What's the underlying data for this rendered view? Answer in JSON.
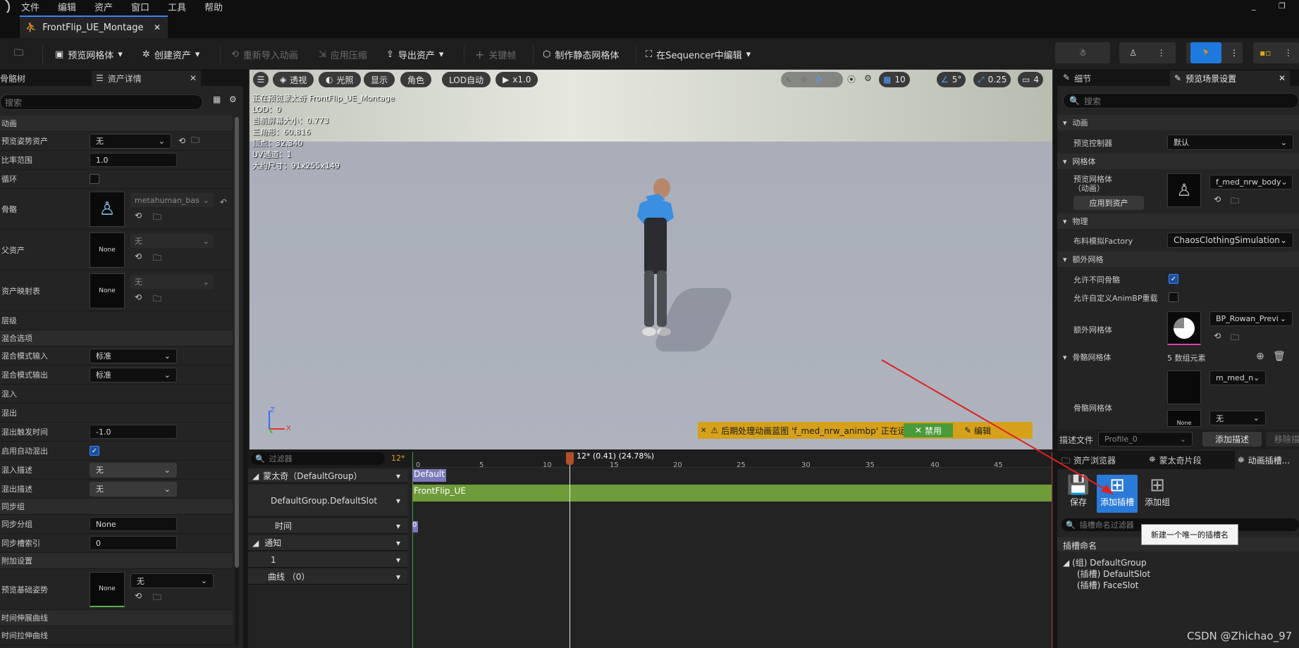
{
  "menu": [
    "文件",
    "编辑",
    "资产",
    "窗口",
    "工具",
    "帮助"
  ],
  "doc_tab": {
    "title": "FrontFlip_UE_Montage"
  },
  "toolbar": {
    "preview_mesh": "预览网格体",
    "create_asset": "创建资产",
    "reimport": "重新导入动画",
    "apply_compress": "应用压缩",
    "export_asset": "导出资产",
    "keyframe": "关键帧",
    "make_static_mesh": "制作静态网格体",
    "edit_in_sequencer": "在Sequencer中编辑"
  },
  "left_tabs": {
    "skeleton_tree": "骨骼树",
    "asset_details": "资产详情"
  },
  "left_search": {
    "placeholder": "搜索"
  },
  "details": {
    "sec_anim": "动画",
    "preview_pose_label": "预览姿势资产",
    "preview_pose_value": "无",
    "rate_label": "比率范围",
    "rate_value": "1.0",
    "loop_label": "循环",
    "skeleton_label": "骨骼",
    "skeleton_value": "metahuman_bas",
    "asset_label": "父资产",
    "asset_value": "无",
    "none1": "None",
    "asset_map_label": "资产映射表",
    "asset_map_value": "无",
    "none2": "None",
    "sec_level": "层级",
    "sec_blend": "混合选项",
    "blend_in_label": "混合模式输入",
    "blend_in_value": "标准",
    "blend_out_label": "混合模式输出",
    "blend_out_value": "标准",
    "blend_in2": "混入",
    "blend_out2": "混出",
    "blend_out_trigger_label": "混出触发时间",
    "blend_out_trigger_value": "-1.0",
    "auto_blend_out_label": "启用自动混出",
    "blend_in_profile_label": "混入描述",
    "blend_in_profile_value": "无",
    "blend_out_profile_label": "混出描述",
    "blend_out_profile_value": "无",
    "sec_sync": "同步组",
    "sync_group_label": "同步分组",
    "sync_group_value": "None",
    "sync_slot_label": "同步槽索引",
    "sync_slot_value": "0",
    "sec_additive": "附加设置",
    "base_pose_label": "预览基础姿势",
    "base_pose_value": "无",
    "none3": "None",
    "sec_timestretch": "时间伸展曲线",
    "timestretch_item": "时间拉伸曲线"
  },
  "viewport": {
    "perspective": "透视",
    "lit": "光照",
    "show": "显示",
    "character": "角色",
    "lod": "LOD自动",
    "play_rate": "x1.0",
    "grid": "10",
    "angle": "5°",
    "scale": "0.25",
    "cam": "4",
    "info": [
      "正在预览蒙太奇 FrontFlip_UE_Montage",
      "LOD：0",
      "当前屏幕大小：0.773",
      "三角形：60,816",
      "顶点：32,340",
      "UV通道：1",
      "大约尺寸：91x255x149"
    ],
    "axis_z": "Z",
    "axis_x": "X"
  },
  "warning": {
    "text": "后期处理动画蓝图 'f_med_nrw_animbp' 正在运行。",
    "disable": "禁用",
    "edit": "编辑"
  },
  "timeline": {
    "filter_placeholder": "过滤器",
    "frame_count": "12*",
    "playhead": "12* (0.41) (24.78%)",
    "ticks": [
      "0",
      "5",
      "10",
      "15",
      "20",
      "25",
      "30",
      "35",
      "40",
      "45"
    ],
    "montage_row": "蒙太奇（DefaultGroup）",
    "slot_row": "DefaultGroup.DefaultSlot",
    "time_row": "时间",
    "notify_row": "通知",
    "notify_track": "1",
    "curves_row": "曲线 （0）",
    "section_default": "Default",
    "anim_segment": "FrontFlip_UE",
    "time_marker": "0"
  },
  "right_tabs": {
    "details": "细节",
    "preview_scene": "预览场景设置"
  },
  "right_search": {
    "placeholder": "搜索"
  },
  "preview_scene": {
    "sec_anim": "动画",
    "controller_label": "预览控制器",
    "controller_value": "默认",
    "sec_mesh": "网格体",
    "preview_mesh_label": "预览网格体\n（动画）",
    "preview_mesh_value": "f_med_nrw_body",
    "apply_btn": "应用到资产",
    "sec_physics": "物理",
    "cloth_label": "布料模拟Factory",
    "cloth_value": "ChaosClothingSimulation",
    "sec_extra": "额外网格",
    "allow_diff_label": "允许不同骨骼",
    "allow_custom_label": "允许自定义AnimBP重载",
    "extra_mesh_label": "额外网格体",
    "extra_mesh_value": "BP_Rowan_Previ",
    "sec_skel_mesh": "骨骼网格体",
    "skel_count": "5 数组元素",
    "skel_mesh_label": "骨骼网格体",
    "skel_item1": "m_med_n",
    "skel_item2": "无",
    "skel_none": "None"
  },
  "profile": {
    "label": "描述文件",
    "value": "Profile_0",
    "add": "添加描述",
    "remove": "移除描"
  },
  "bottom_tabs": {
    "asset_browser": "资产浏览器",
    "montage_section": "蒙太奇片段",
    "anim_slots": "动画插槽..."
  },
  "slot_manager": {
    "save": "保存",
    "add_slot": "添加插槽",
    "add_group": "添加组",
    "filter_placeholder": "插槽命名过滤器",
    "tooltip": "新建一个唯一的插槽名",
    "header": "插槽命名",
    "group": "(组) DefaultGroup",
    "slot1": "(插槽) DefaultSlot",
    "slot2": "(插槽) FaceSlot"
  },
  "watermark": "CSDN @Zhichao_97",
  "colors": {
    "accent": "#3b82f6",
    "segment": "#6f9c3a",
    "warning": "#d6a11a",
    "section": "#7a7ab8"
  }
}
